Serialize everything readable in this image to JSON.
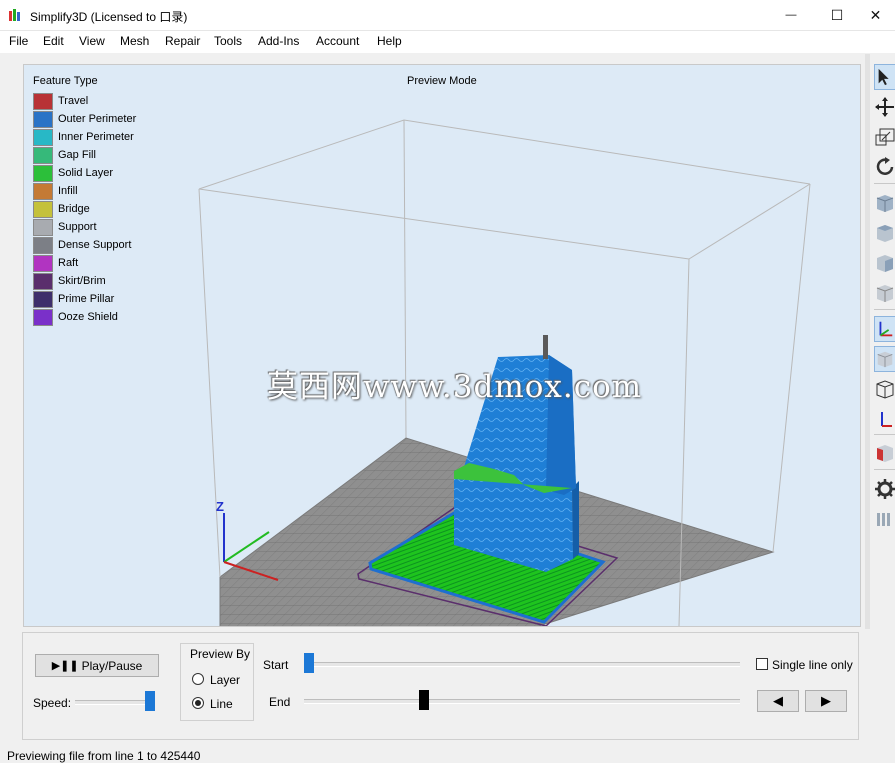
{
  "window": {
    "title": "Simplify3D (Licensed to 口录)",
    "minimize_glyph": "—",
    "maximize_glyph": "☐",
    "close_glyph": "✕"
  },
  "menu": [
    "File",
    "Edit",
    "View",
    "Mesh",
    "Repair",
    "Tools",
    "Add-Ins",
    "Account",
    "Help"
  ],
  "viewport": {
    "legend_title": "Feature Type",
    "mode_label": "Preview Mode",
    "watermark": "莫西网www.3dmox.com",
    "axis_label": "Z",
    "legend": [
      {
        "label": "Travel",
        "color": "#b83236"
      },
      {
        "label": "Outer Perimeter",
        "color": "#2a73c6"
      },
      {
        "label": "Inner Perimeter",
        "color": "#28b8c6"
      },
      {
        "label": "Gap Fill",
        "color": "#36b97a"
      },
      {
        "label": "Solid Layer",
        "color": "#2cbf3a"
      },
      {
        "label": "Infill",
        "color": "#c47a35"
      },
      {
        "label": "Bridge",
        "color": "#c4c13b"
      },
      {
        "label": "Support",
        "color": "#a8abb0"
      },
      {
        "label": "Dense Support",
        "color": "#7c7f86"
      },
      {
        "label": "Raft",
        "color": "#b134c1"
      },
      {
        "label": "Skirt/Brim",
        "color": "#5a2e6c"
      },
      {
        "label": "Prime Pillar",
        "color": "#3e2f6b"
      },
      {
        "label": "Ooze Shield",
        "color": "#7a30c9"
      }
    ]
  },
  "toolbar_icons": [
    "select-arrow-icon",
    "move-icon",
    "scale-icon",
    "rotate-icon",
    "view-front-cube-icon",
    "view-top-cube-icon",
    "view-side-cube-icon",
    "view-iso-cube-icon",
    "axes-icon",
    "solid-cube-icon",
    "wireframe-cube-icon",
    "build-axes-icon",
    "cross-section-icon",
    "settings-gear-icon",
    "layers-icon"
  ],
  "controls": {
    "play_pause_label": "Play/Pause",
    "play_pause_glyph": "▶❚❚",
    "speed_label": "Speed:",
    "speed_value": 1.0,
    "preview_by_label": "Preview By",
    "preview_by_options": [
      "Layer",
      "Line"
    ],
    "preview_by_selected": "Line",
    "start_label": "Start",
    "end_label": "End",
    "start_position": 0.0,
    "end_position": 0.27,
    "single_line_label": "Single line only",
    "single_line_checked": false,
    "prev_glyph": "◀",
    "next_glyph": "▶"
  },
  "status": {
    "text": "Previewing file from line 1 to 425440"
  }
}
